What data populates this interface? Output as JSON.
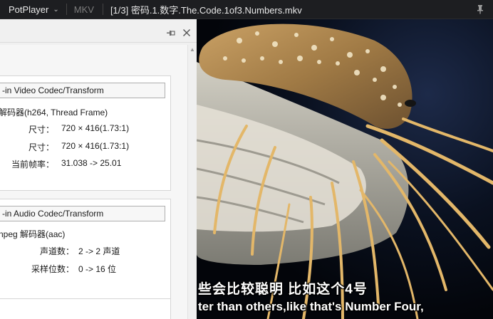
{
  "titlebar": {
    "app_name": "PotPlayer",
    "format": "MKV",
    "file_title": "[1/3] 密码.1.数字.The.Code.1of3.Numbers.mkv"
  },
  "video_info": {
    "video_group_button": "-in Video Codec/Transform",
    "video_decoder": "解码器(h264, Thread Frame)",
    "rows": [
      {
        "label": "尺寸：",
        "value": "720 × 416(1.73:1)"
      },
      {
        "label": "尺寸：",
        "value": "720 × 416(1.73:1)"
      },
      {
        "label": "当前帧率：",
        "value": "31.038 -> 25.01"
      }
    ]
  },
  "audio_info": {
    "audio_group_button": "-in Audio Codec/Transform",
    "audio_decoder": "npeg 解码器(aac)",
    "rows": [
      {
        "label": "声道数：",
        "value": "2 -> 2 声道"
      },
      {
        "label": "采样位数：",
        "value": "0 -> 16 位"
      }
    ]
  },
  "subtitles": {
    "chinese": "些会比较聪明 比如这个4号",
    "english": "ter than others,like that's Number Four,"
  },
  "colors": {
    "titlebar_bg": "#1d1e21",
    "panel_bg": "#f0f0f0",
    "video_bg": "#05070c"
  }
}
